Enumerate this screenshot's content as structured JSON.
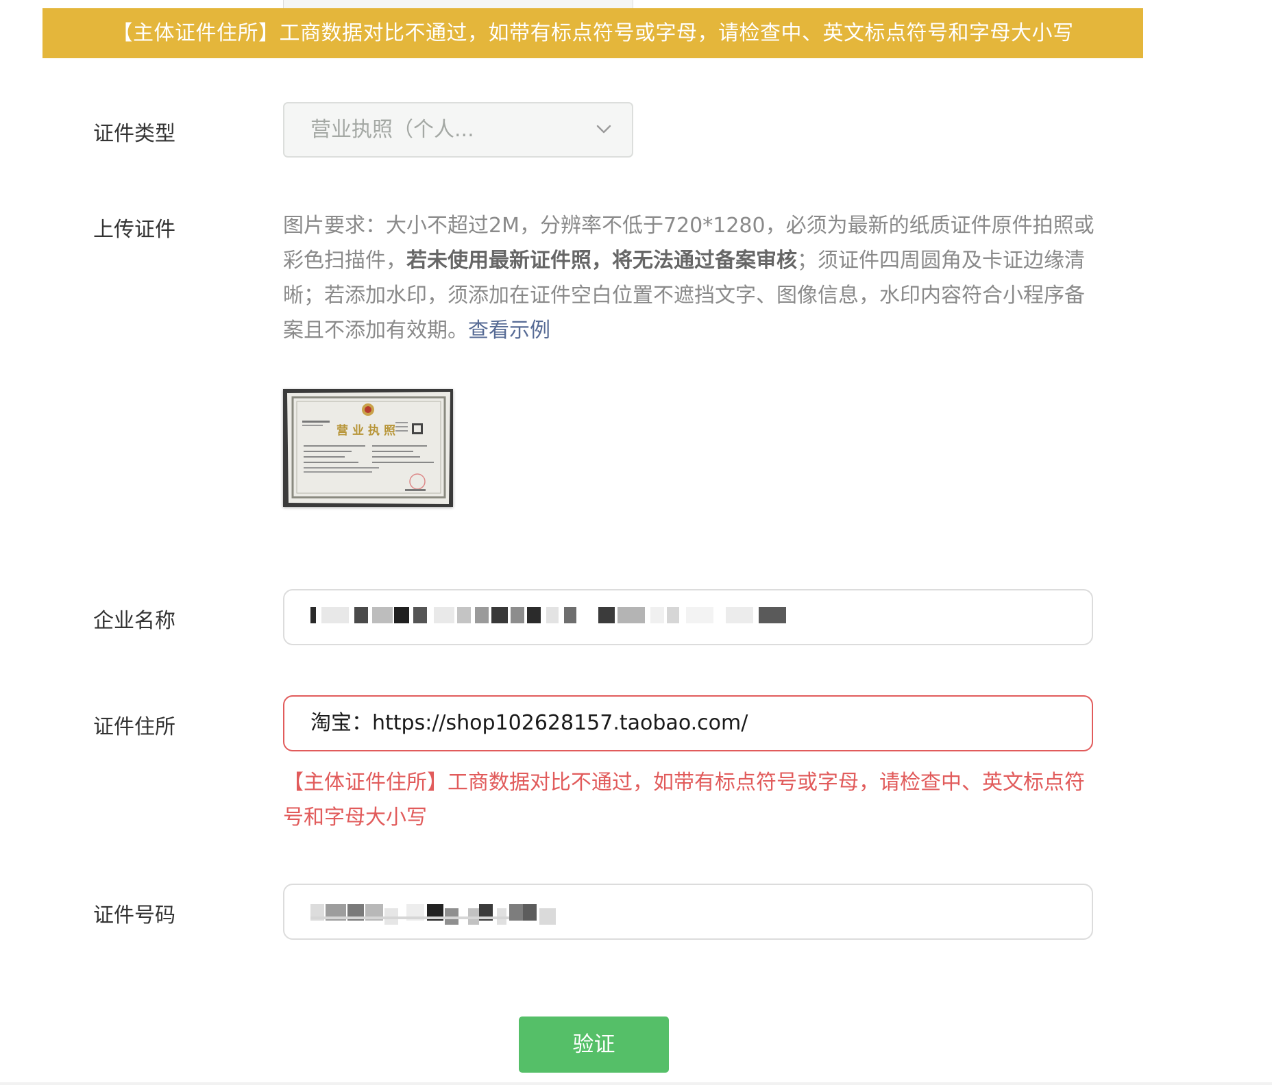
{
  "banner": {
    "message": "【主体证件住所】工商数据对比不通过，如带有标点符号或字母，请检查中、英文标点符号和字母大小写"
  },
  "form": {
    "cert_type": {
      "label": "证件类型",
      "value": "营业执照（个人..."
    },
    "upload": {
      "label": "上传证件",
      "req_part1": "图片要求：大小不超过2M，分辨率不低于720*1280，必须为最新的纸质证件原件拍照或彩色扫描件，",
      "req_bold": "若未使用最新证件照，将无法通过备案审核",
      "req_part2": "；须证件四周圆角及卡证边缘清晰；若添加水印，须添加在证件空白位置不遮挡文字、图像信息，水印内容符合小程序备案且不添加有效期。",
      "example_link": "查看示例",
      "thumbnail_title": "营业执照"
    },
    "company_name": {
      "label": "企业名称"
    },
    "cert_address": {
      "label": "证件住所",
      "value": "淘宝：https://shop102628157.taobao.com/",
      "error": "【主体证件住所】工商数据对比不通过，如带有标点符号或字母，请检查中、英文标点符号和字母大小写"
    },
    "cert_number": {
      "label": "证件号码"
    },
    "verify_button": "验证"
  },
  "colors": {
    "banner": "#e4b63b",
    "error": "#e15b5b",
    "link": "#576b95",
    "button": "#55bf68"
  }
}
